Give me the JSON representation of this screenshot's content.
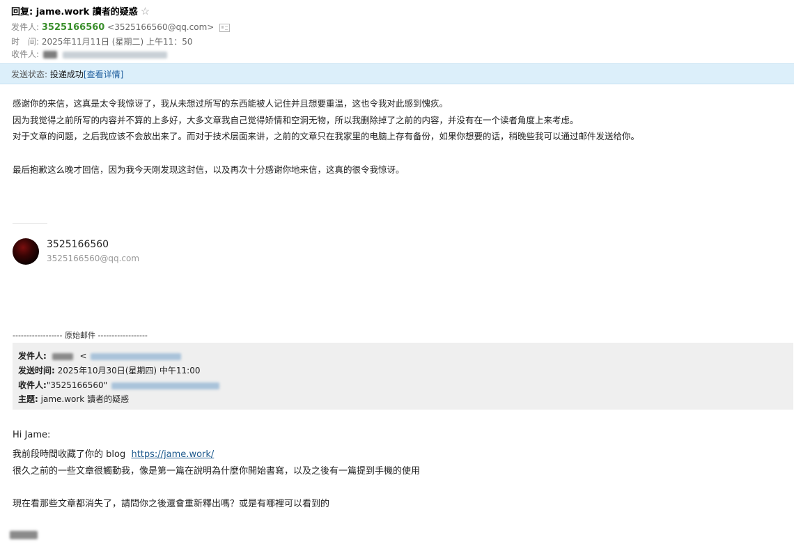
{
  "header": {
    "subject": "回复: jame.work 讀者的疑惑",
    "star_icon": "☆",
    "from_label": "发件人:",
    "from_name": "3525166560",
    "from_email": "<3525166560@qq.com>",
    "time_label": "时　间:",
    "time_value": "2025年11月11日 (星期二) 上午11：50",
    "to_label": "收件人:"
  },
  "status": {
    "label": "发送状态:",
    "value": "投递成功",
    "link": "[查看详情]"
  },
  "reply": {
    "lines": [
      "感谢你的来信，这真是太令我惊讶了，我从未想过所写的东西能被人记住并且想要重温，这也令我对此感到愧疚。",
      "因为我觉得之前所写的内容并不算的上多好，大多文章我自己觉得矫情和空洞无物，所以我删除掉了之前的内容，并没有在一个读者角度上来考虑。",
      "对于文章的问题，之后我应该不会放出来了。而对于技术层面来讲，之前的文章只在我家里的电脑上存有备份，如果你想要的话，稍晚些我可以通过邮件发送给你。",
      "最后抱歉这么晚才回信，因为我今天刚发现这封信，以及再次十分感谢你地来信，这真的很令我惊讶。"
    ]
  },
  "signature": {
    "name": "3525166560",
    "email": "3525166560@qq.com"
  },
  "original": {
    "separator": "------------------ 原始邮件 ------------------",
    "from_label": "发件人:",
    "from_bracket": "<",
    "time_label": "发送时间:",
    "time_value": "2025年10月30日(星期四) 中午11:00",
    "to_label": "收件人:",
    "to_value": "\"3525166560\"",
    "subject_label": "主题:",
    "subject_value": "jame.work 讀者的疑惑"
  },
  "original_body": {
    "greeting": "Hi Jame:",
    "line1": "我前段時間收藏了你的 blog",
    "link": "https://jame.work/",
    "line2": "很久之前的一些文章很觸動我，像是第一篇在說明為什麼你開始書寫，以及之後有一篇提到手機的使用",
    "line3": "現在看那些文章都消失了，請問你之後還會重新釋出嗎？或是有哪裡可以看到的"
  }
}
